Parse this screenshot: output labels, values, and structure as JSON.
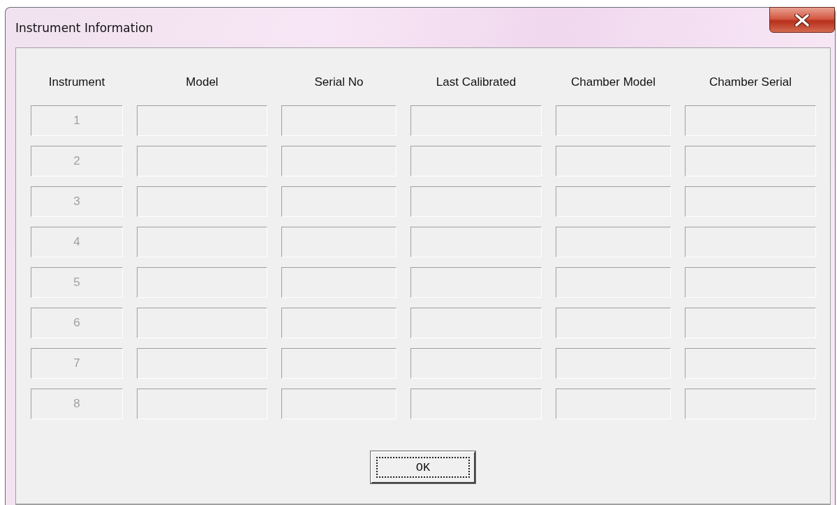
{
  "window": {
    "title": "Instrument Information"
  },
  "columns": [
    "Instrument",
    "Model",
    "Serial No",
    "Last Calibrated",
    "Chamber Model",
    "Chamber Serial"
  ],
  "rows": [
    {
      "instrument": "1",
      "disabled": true
    },
    {
      "instrument": "2",
      "disabled": true
    },
    {
      "instrument": "3",
      "disabled": true
    },
    {
      "instrument": "4",
      "disabled": true
    },
    {
      "instrument": "5",
      "disabled": true
    },
    {
      "instrument": "6",
      "disabled": true
    },
    {
      "instrument": "7",
      "disabled": true
    },
    {
      "instrument": "8",
      "disabled": true
    }
  ],
  "buttons": [
    {
      "label": "OK",
      "focused": true
    }
  ]
}
